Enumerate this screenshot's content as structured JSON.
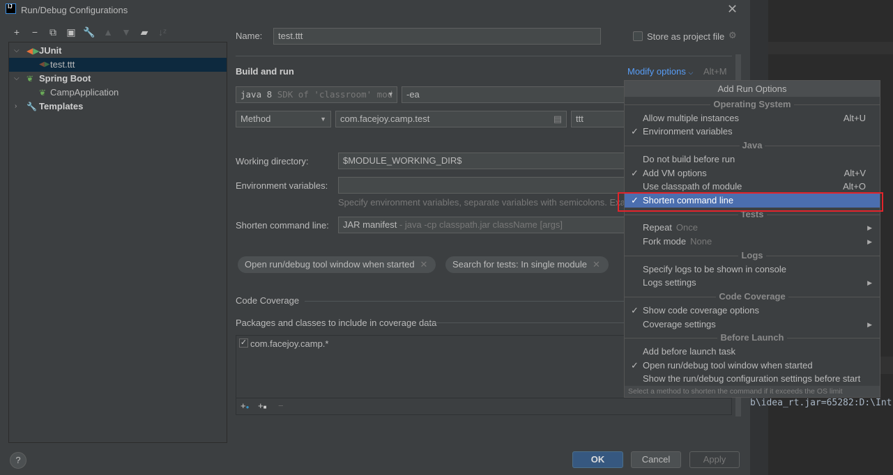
{
  "window": {
    "title": "Run/Debug Configurations",
    "logo": "IJ"
  },
  "toolbar": {
    "icons": [
      "add-icon",
      "remove-icon",
      "copy-icon",
      "save-icon",
      "wrench-icon",
      "move-up-icon",
      "move-down-icon",
      "new-folder-icon",
      "sort-icon"
    ]
  },
  "tree": {
    "junit": "JUnit",
    "junit_child": "test.ttt",
    "springboot": "Spring Boot",
    "springboot_child": "CampApplication",
    "templates": "Templates"
  },
  "form": {
    "name_label": "Name:",
    "name_value": "test.ttt",
    "store_label": "Store as project file",
    "store_checked": false,
    "build_run": "Build and run",
    "modify_options": "Modify options",
    "modify_shortcut": "Alt+M",
    "jre_main": "java 8",
    "jre_hint": "SDK of 'classroom' mod",
    "vm_options": "-ea",
    "test_kind": "Method",
    "class_value": "com.facejoy.camp.test",
    "method_value": "ttt",
    "workdir_label": "Working directory:",
    "workdir_value": "$MODULE_WORKING_DIR$",
    "env_label": "Environment variables:",
    "env_value": "",
    "env_hint": "Specify environment variables, separate variables with semicolons. Exa",
    "shorten_label": "Shorten command line:",
    "shorten_value": "JAR manifest",
    "shorten_hint": " - java -cp classpath.jar className [args]",
    "chips": [
      "Open run/debug tool window when started",
      "Search for tests: In single module"
    ],
    "coverage_title": "Code Coverage",
    "coverage_packages": "Packages and classes to include in coverage data",
    "coverage_item": "com.facejoy.camp.*",
    "coverage_item_checked": true
  },
  "buttons": {
    "ok": "OK",
    "cancel": "Cancel",
    "apply": "Apply",
    "help": "?"
  },
  "console": {
    "text": "b\\idea_rt.jar=65282:D:\\Int"
  },
  "menu": {
    "title": "Add Run Options",
    "rows": [
      {
        "type": "header",
        "label": "Operating System"
      },
      {
        "label": "Allow multiple instances",
        "checked": false,
        "shortcut": "Alt+U"
      },
      {
        "label": "Environment variables",
        "checked": true
      },
      {
        "type": "header",
        "label": "Java"
      },
      {
        "label": "Do not build before run",
        "checked": false
      },
      {
        "label": "Add VM options",
        "checked": true,
        "shortcut": "Alt+V"
      },
      {
        "label": "Use classpath of module",
        "checked": false,
        "shortcut": "Alt+O"
      },
      {
        "label": "Shorten command line",
        "checked": true,
        "selected": true
      },
      {
        "type": "header",
        "label": "Tests"
      },
      {
        "label": "Repeat",
        "hint": "Once",
        "submenu": true
      },
      {
        "label": "Fork mode",
        "hint": "None",
        "submenu": true
      },
      {
        "type": "header",
        "label": "Logs"
      },
      {
        "label": "Specify logs to be shown in console"
      },
      {
        "label": "Logs settings",
        "submenu": true
      },
      {
        "type": "header",
        "label": "Code Coverage"
      },
      {
        "label": "Show code coverage options",
        "checked": true
      },
      {
        "label": "Coverage settings",
        "submenu": true
      },
      {
        "type": "header",
        "label": "Before Launch"
      },
      {
        "label": "Add before launch task"
      },
      {
        "label": "Open run/debug tool window when started",
        "checked": true
      },
      {
        "label": "Show the run/debug configuration settings before start"
      }
    ],
    "footer": "Select a method to shorten the command if it exceeds the OS limit"
  },
  "colors": {
    "selection": "#4b6eaf",
    "highlight": "#e3242b",
    "ok_button": "#365880"
  }
}
